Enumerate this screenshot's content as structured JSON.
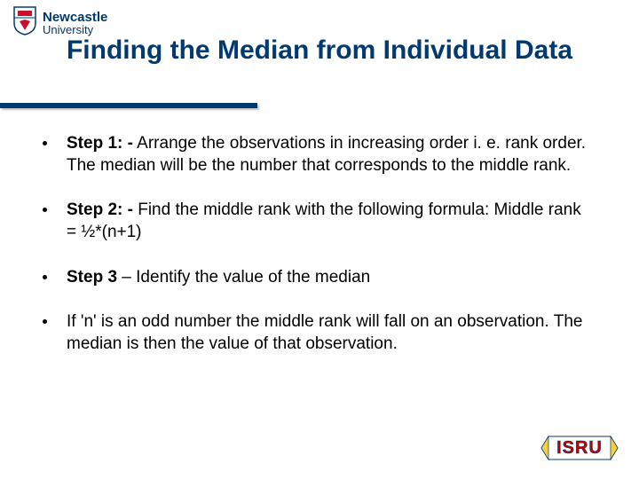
{
  "logo": {
    "name": "Newcastle",
    "sub": "University"
  },
  "title": "Finding the Median from Individual Data",
  "bullets": [
    {
      "label": "Step 1: -",
      "text": "  Arrange the observations in increasing order i. e. rank order. The median will be the number that corresponds to the middle rank."
    },
    {
      "label": "Step 2: -",
      "text": " Find the middle rank with the following formula: Middle rank = ½*(n+1)"
    },
    {
      "label": "Step 3",
      "text": " – Identify the value of the median"
    },
    {
      "label": "",
      "text": "If 'n' is an odd number the middle rank will fall on an observation. The median is then the value of that observation."
    }
  ],
  "isru": "ISRU"
}
